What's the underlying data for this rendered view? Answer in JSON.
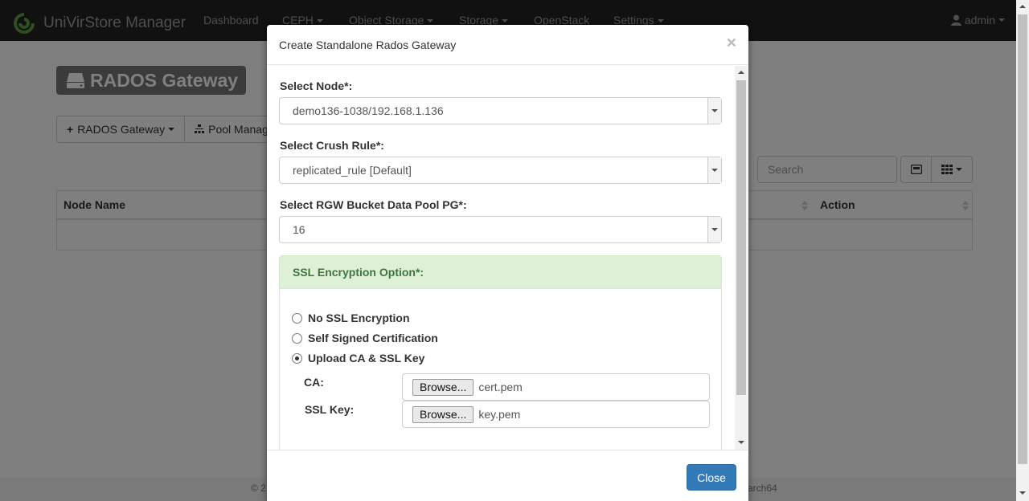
{
  "navbar": {
    "brand": "UniVirStore Manager",
    "items": [
      "Dashboard",
      "CEPH",
      "Object Storage",
      "Storage",
      "OpenStack",
      "Settings"
    ],
    "user": "admin"
  },
  "page": {
    "title": "RADOS Gateway",
    "buttons": [
      "RADOS Gateway",
      "Pool Manag"
    ],
    "search_placeholder": "Search",
    "table_headers": [
      "Node Name",
      "Action"
    ],
    "footer_left": "© 2",
    "footer_right": "arch64"
  },
  "modal": {
    "title": "Create Standalone Rados Gateway",
    "close_x": "×",
    "node_label": "Select Node*:",
    "node_value": "demo136-1038/192.168.1.136",
    "crush_label": "Select Crush Rule*:",
    "crush_value": "replicated_rule [Default]",
    "pg_label": "Select RGW Bucket Data Pool PG*:",
    "pg_value": "16",
    "ssl_heading": "SSL Encryption Option*:",
    "ssl_options": [
      "No SSL Encryption",
      "Self Signed Certification",
      "Upload CA & SSL Key"
    ],
    "ssl_selected_index": 2,
    "ca_label": "CA:",
    "ca_browse": "Browse...",
    "ca_file": "cert.pem",
    "key_label": "SSL Key:",
    "key_browse": "Browse...",
    "key_file": "key.pem",
    "close_button": "Close"
  }
}
